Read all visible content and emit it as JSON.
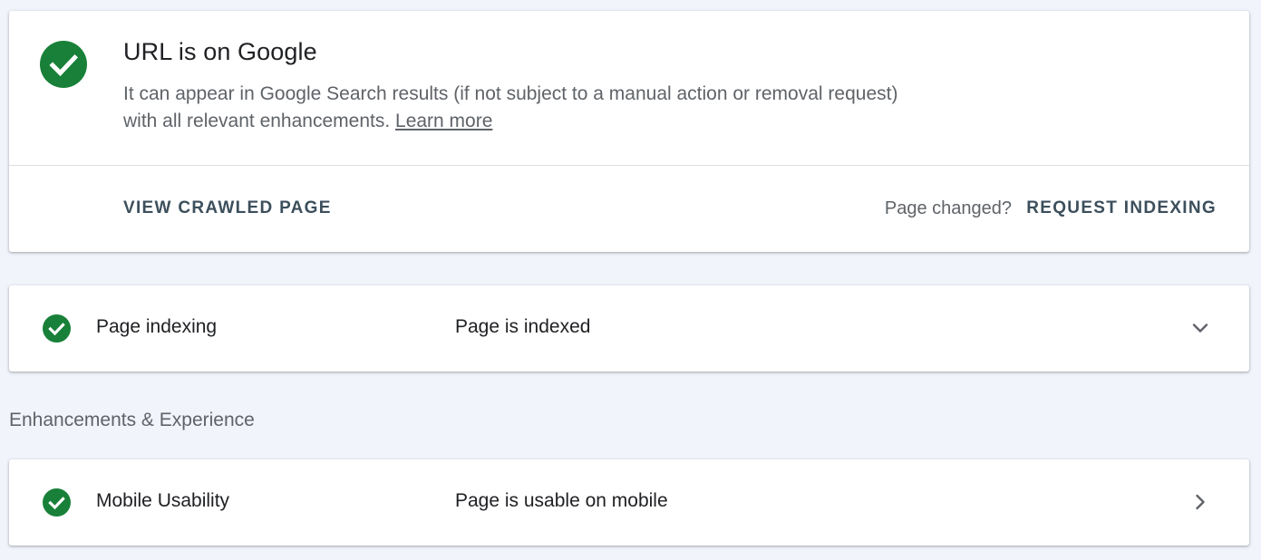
{
  "colors": {
    "success": "#188038",
    "background": "#f1f4fb",
    "action_text": "#3c4f5c"
  },
  "status": {
    "icon": "check-circle-icon",
    "title": "URL is on Google",
    "description": "It can appear in Google Search results (if not subject to a manual action or removal request) with all relevant enhancements.",
    "learn_more": "Learn more",
    "view_crawled_label": "VIEW CRAWLED PAGE",
    "page_changed_text": "Page changed?",
    "request_indexing_label": "REQUEST INDEXING"
  },
  "indexing": {
    "icon": "check-circle-icon",
    "label": "Page indexing",
    "value": "Page is indexed",
    "toggle_icon": "chevron-down-icon"
  },
  "enhancements": {
    "heading": "Enhancements & Experience",
    "items": [
      {
        "icon": "check-circle-icon",
        "label": "Mobile Usability",
        "value": "Page is usable on mobile",
        "toggle_icon": "chevron-right-icon"
      }
    ]
  }
}
